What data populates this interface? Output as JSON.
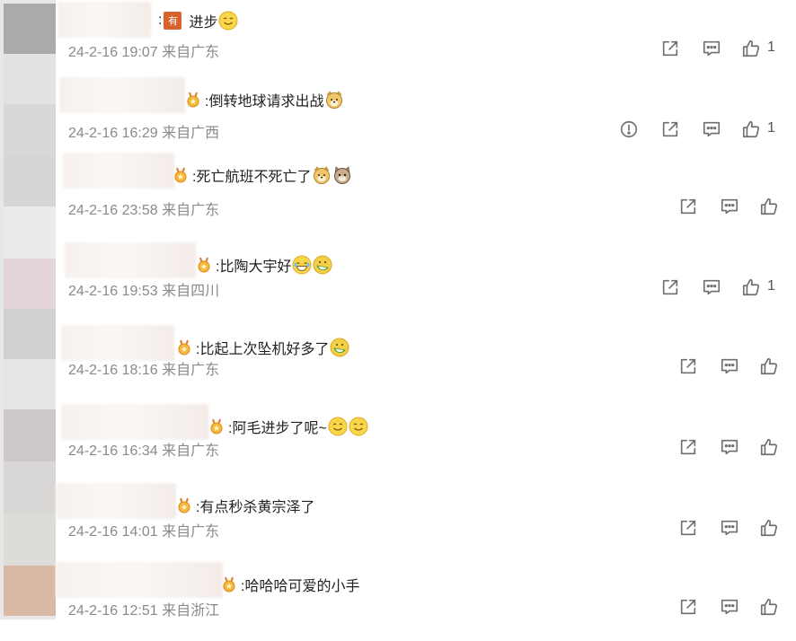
{
  "comments": [
    {
      "badge": "有",
      "text": "进步",
      "emojis": [
        "smile"
      ],
      "time": "24-2-16 19:07",
      "source": "来自广东",
      "likes": "1",
      "report": false
    },
    {
      "badge": "",
      "text": ":倒转地球请求出战",
      "emojis": [
        "dog"
      ],
      "time": "24-2-16 16:29",
      "source": "来自广西",
      "likes": "1",
      "report": true
    },
    {
      "badge": "",
      "text": ":死亡航班不死亡了",
      "emojis": [
        "dog",
        "cat"
      ],
      "time": "24-2-16 23:58",
      "source": "来自广东",
      "likes": "",
      "report": false
    },
    {
      "badge": "",
      "text": ":比陶大宇好",
      "emojis": [
        "laugh",
        "melon"
      ],
      "time": "24-2-16 19:53",
      "source": "来自四川",
      "likes": "1",
      "report": false
    },
    {
      "badge": "",
      "text": ":比起上次坠机好多了",
      "emojis": [
        "melon"
      ],
      "time": "24-2-16 18:16",
      "source": "来自广东",
      "likes": "",
      "report": false
    },
    {
      "badge": "",
      "text": ":阿毛进步了呢~",
      "emojis": [
        "smile",
        "smile"
      ],
      "time": "24-2-16 16:34",
      "source": "来自广东",
      "likes": "",
      "report": false
    },
    {
      "badge": "",
      "text": ":有点秒杀黄宗泽了",
      "emojis": [],
      "time": "24-2-16 14:01",
      "source": "来自广东",
      "likes": "",
      "report": false
    },
    {
      "badge": "",
      "text": ":哈哈哈可爱的小手",
      "emojis": [],
      "time": "24-2-16 12:51",
      "source": "来自浙江",
      "likes": "",
      "report": false
    }
  ],
  "icons": {
    "share": "share-icon",
    "reply": "comment-icon",
    "like": "thumb-up-icon",
    "report": "report-icon"
  },
  "colors": {
    "badge": "#d8612d",
    "meta": "#8a8a8a",
    "text": "#222222",
    "icon": "#6f6f6f"
  }
}
